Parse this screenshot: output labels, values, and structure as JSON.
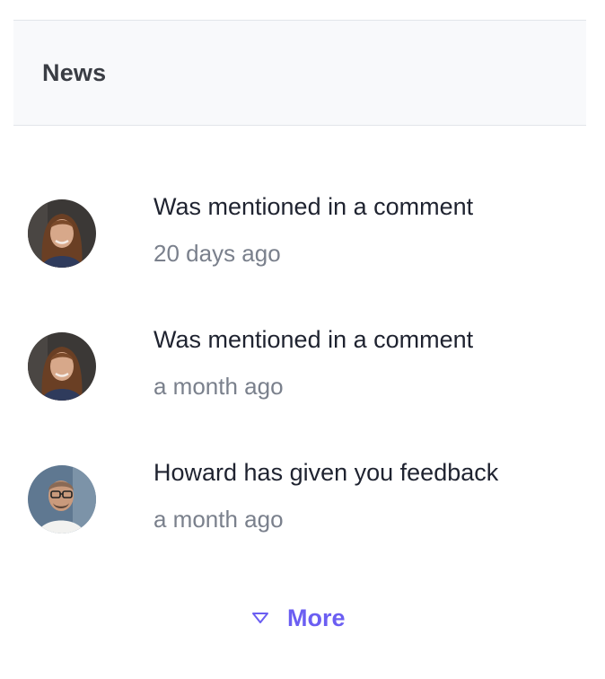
{
  "panel": {
    "title": "News"
  },
  "news": {
    "items": [
      {
        "title": "Was mentioned in a comment",
        "time": "20 days ago",
        "avatar": "woman-portrait"
      },
      {
        "title": "Was mentioned in a comment",
        "time": "a month ago",
        "avatar": "woman-portrait"
      },
      {
        "title": "Howard has given you feedback",
        "time": "a month ago",
        "avatar": "man-portrait"
      }
    ]
  },
  "more": {
    "label": "More",
    "icon": "chevron-down-icon"
  },
  "colors": {
    "accent": "#6b5ef2",
    "title_text": "#1f2330",
    "muted_text": "#7a808c",
    "header_bg": "#f8f9fb"
  }
}
